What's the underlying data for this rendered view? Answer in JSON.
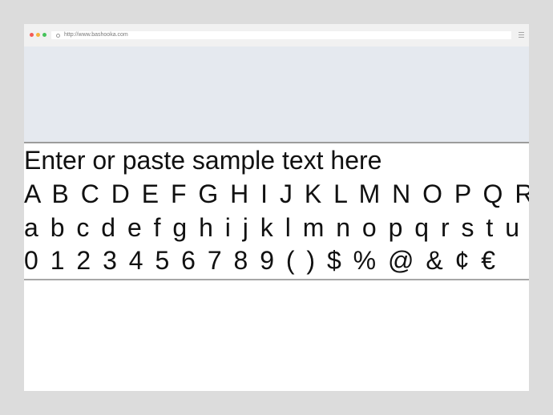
{
  "browser": {
    "url": "http://www.bashooka.com",
    "controls": {
      "close_color": "#f45b55",
      "minimize_color": "#f6b53d",
      "maximize_color": "#45c35a"
    },
    "icons": {
      "lock": "lock-icon",
      "menu": "hamburger-menu-icon"
    }
  },
  "sample": {
    "line1": "Enter or paste sample text here",
    "line2": "A B C D E F G H I J K L M N O P Q R S",
    "line3": "a b c d e f g h i j k l m n o p q r s t u v w",
    "line4": "0 1 2 3 4 5 6 7 8 9 ( ) $ % @ & ¢ €"
  },
  "colors": {
    "hero_background": "#e5e9ef",
    "page_background": "#dcdcdc",
    "text": "#111111"
  }
}
